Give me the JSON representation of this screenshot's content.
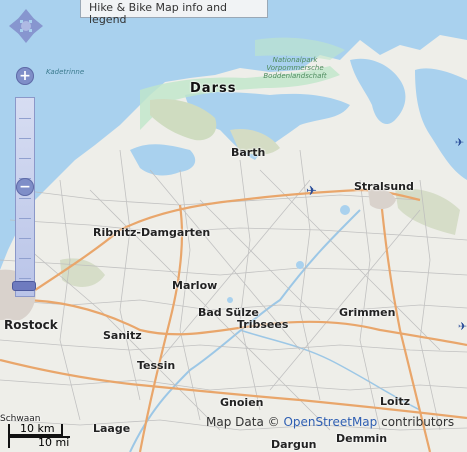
{
  "legend_button": {
    "label": "Hike & Bike Map info and legend"
  },
  "labels": {
    "darss": "Darss",
    "barth": "Barth",
    "stralsund": "Stralsund",
    "ribnitz": "Ribnitz-Damgarten",
    "marlow": "Marlow",
    "rostock": "Rostock",
    "bad_sulze": "Bad Sülze",
    "tribsees": "Tribsees",
    "grimmen": "Grimmen",
    "sanitz": "Sanitz",
    "tessin": "Tessin",
    "gnoien": "Gnoien",
    "loitz": "Loitz",
    "dargun": "Dargun",
    "demmin": "Demmin",
    "laage": "Laage",
    "schwaan": "Schwaan",
    "kadetrinne": "Kadetrinne",
    "nationalpark": "Nationalpark Vorpommersche Boddenlandschaft"
  },
  "controls": {
    "zoom_in": "+",
    "zoom_out": "−"
  },
  "attribution": {
    "prefix": "Map Data ©",
    "link": "OpenStreetMap",
    "suffix": "contributors"
  },
  "scale": {
    "top": "10 km",
    "bottom": "10 mi"
  },
  "colors": {
    "sea": "#a9d1ee",
    "land": "#f0f0ec",
    "forest": "#c8dcc0",
    "park": "#bfe6c9",
    "road_main": "#e9a66b",
    "road_minor": "#bdbdbd"
  }
}
